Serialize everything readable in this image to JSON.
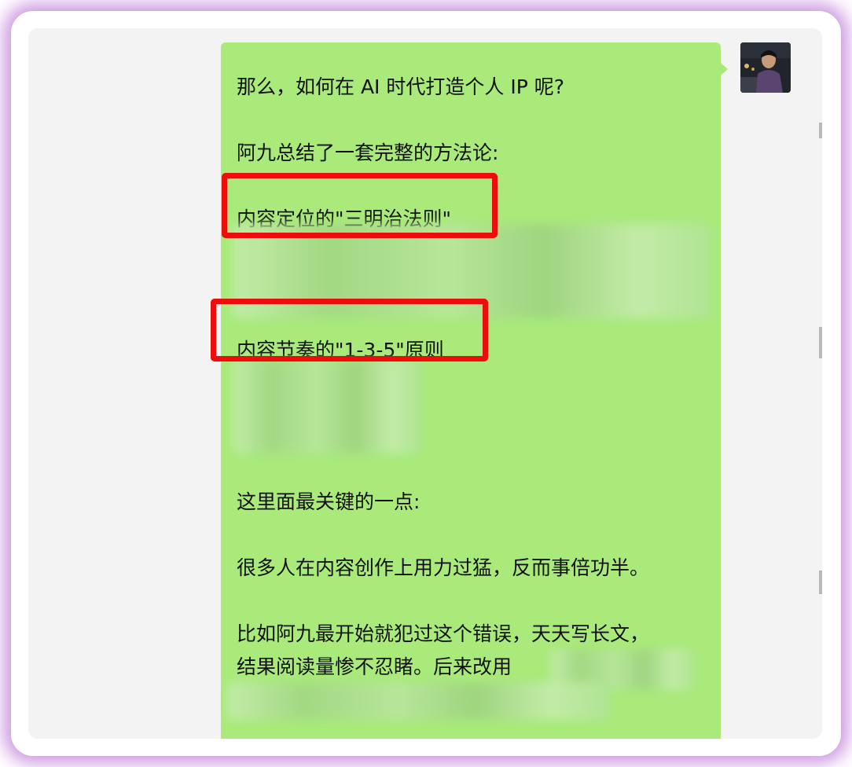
{
  "chat": {
    "lines": [
      "那么，如何在 AI 时代打造个人 IP 呢?",
      "阿九总结了一套完整的方法论:",
      "内容定位的\"三明治法则\"",
      "内容节奏的\"1-3-5\"原则",
      "这里面最关键的一点:",
      "很多人在内容创作上用力过猛，反而事倍功半。",
      "比如阿九最开始就犯过这个错误，天天写长文，",
      "结果阅读量惨不忍睹。后来改用"
    ]
  },
  "colors": {
    "bubble": "#a9ea7a",
    "highlight_box": "#ee0d0d",
    "window_bg": "#f3f3f3",
    "glow": "#be78d7"
  }
}
